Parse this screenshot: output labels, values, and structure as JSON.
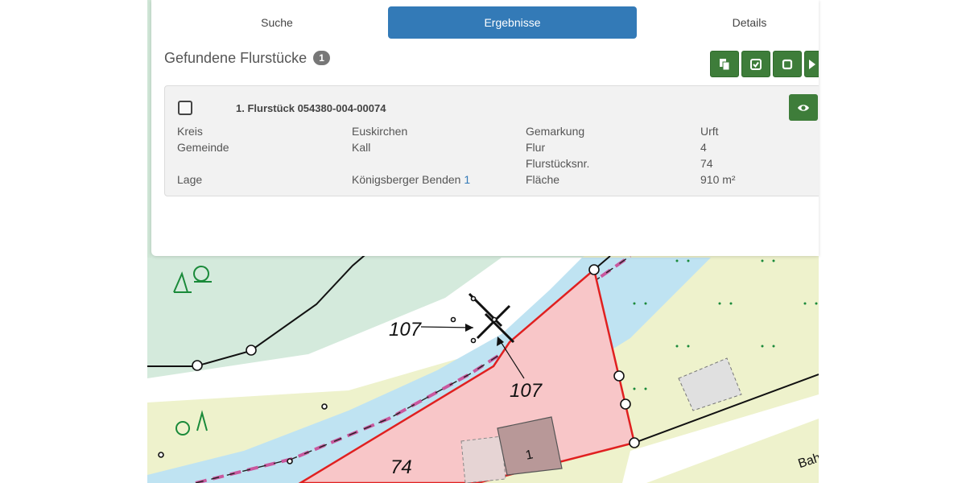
{
  "tabs": {
    "search": "Suche",
    "results": "Ergebnisse",
    "details": "Details"
  },
  "results": {
    "heading": "Gefundene Flurstücke",
    "count": "1"
  },
  "toolbar_buttons": [
    {
      "icon": "copy-icon"
    },
    {
      "icon": "check-square-icon"
    },
    {
      "icon": "square-icon"
    },
    {
      "icon": "play-icon"
    }
  ],
  "parcel": {
    "title": "1. Flurstück 054380-004-00074",
    "kreis_label": "Kreis",
    "kreis_value": "Euskirchen",
    "gemeinde_label": "Gemeinde",
    "gemeinde_value": "Kall",
    "lage_label": "Lage",
    "lage_street": "Königsberger Benden",
    "lage_number": "1",
    "gemarkung_label": "Gemarkung",
    "gemarkung_value": "Urft",
    "flur_label": "Flur",
    "flur_value": "4",
    "flurstuecksnr_label": "Flurstücksnr.",
    "flurstuecksnr_value": "74",
    "flaeche_label": "Fläche",
    "flaeche_value": "910 m²"
  },
  "map": {
    "label_107_a": "107",
    "label_107_b": "107",
    "parcel_number": "74",
    "building_number": "1",
    "street_fragment": "Bah"
  },
  "colors": {
    "accent": "#337ab7",
    "button_green": "#3e7d3a",
    "parcel_fill": "#f8c6c8",
    "parcel_border": "#e02020",
    "water": "#bfe3f2",
    "meadow": "#d4eadc",
    "field": "#eef2cc"
  }
}
